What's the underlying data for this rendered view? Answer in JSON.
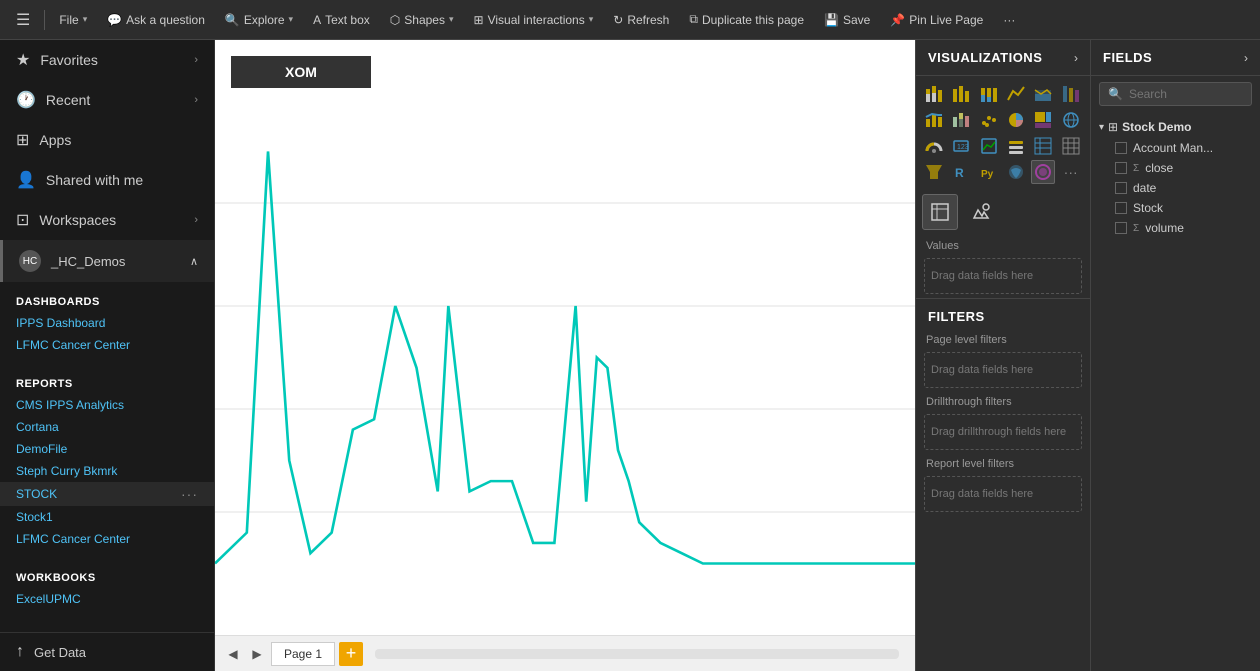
{
  "toolbar": {
    "hamburger": "☰",
    "items": [
      {
        "label": "File",
        "hasChevron": true
      },
      {
        "label": "Ask a question",
        "hasChevron": false
      },
      {
        "label": "Explore",
        "hasChevron": true
      },
      {
        "label": "Text box",
        "hasChevron": false
      },
      {
        "label": "Shapes",
        "hasChevron": true
      },
      {
        "label": "Visual interactions",
        "hasChevron": true
      },
      {
        "label": "Refresh",
        "hasChevron": false
      },
      {
        "label": "Duplicate this page",
        "hasChevron": false
      },
      {
        "label": "Save",
        "hasChevron": false
      },
      {
        "label": "Pin Live Page",
        "hasChevron": false
      },
      {
        "label": "···",
        "hasChevron": false
      }
    ]
  },
  "sidebar": {
    "items": [
      {
        "icon": "★",
        "label": "Favorites",
        "hasChevron": true
      },
      {
        "icon": "⏱",
        "label": "Recent",
        "hasChevron": true
      },
      {
        "icon": "⊞",
        "label": "Apps",
        "hasChevron": false
      },
      {
        "icon": "👤",
        "label": "Shared with me",
        "hasChevron": false
      },
      {
        "icon": "⊡",
        "label": "Workspaces",
        "hasChevron": true
      }
    ],
    "workspace": {
      "avatar_text": "HC",
      "label": "_HC_Demos",
      "expanded": true
    },
    "dashboards_label": "DASHBOARDS",
    "dashboards": [
      "IPPS Dashboard",
      "LFMC Cancer Center"
    ],
    "reports_label": "REPORTS",
    "reports": [
      "CMS IPPS Analytics",
      "Cortana",
      "DemoFile",
      "Steph Curry Bkmrk"
    ],
    "active_report": "STOCK",
    "more_reports": [
      "Stock1",
      "LFMC Cancer Center"
    ],
    "workbooks_label": "WORKBOOKS",
    "workbooks": [
      "ExcelUPMC"
    ],
    "get_data_label": "Get Data",
    "get_data_icon": "↑"
  },
  "canvas": {
    "xom_label": "XOM",
    "page_label": "Page 1"
  },
  "visualizations": {
    "title": "VISUALIZATIONS",
    "chevron": "›",
    "sections": {
      "values_label": "Values",
      "values_placeholder": "Drag data fields here"
    }
  },
  "filters": {
    "title": "FILTERS",
    "page_level": "Page level filters",
    "drag_page": "Drag data fields here",
    "drillthrough": "Drillthrough filters",
    "drag_drill": "Drag drillthrough fields here",
    "report_level": "Report level filters",
    "drag_report": "Drag data fields here"
  },
  "fields": {
    "title": "FIELDS",
    "search_placeholder": "Search",
    "groups": [
      {
        "name": "Stock Demo",
        "items": [
          {
            "name": "Account Man...",
            "type": "text",
            "sigma": false
          },
          {
            "name": "close",
            "type": "sigma",
            "sigma": true
          },
          {
            "name": "date",
            "type": "text",
            "sigma": false
          },
          {
            "name": "Stock",
            "type": "text",
            "sigma": false
          },
          {
            "name": "volume",
            "type": "sigma",
            "sigma": true
          }
        ]
      }
    ]
  }
}
